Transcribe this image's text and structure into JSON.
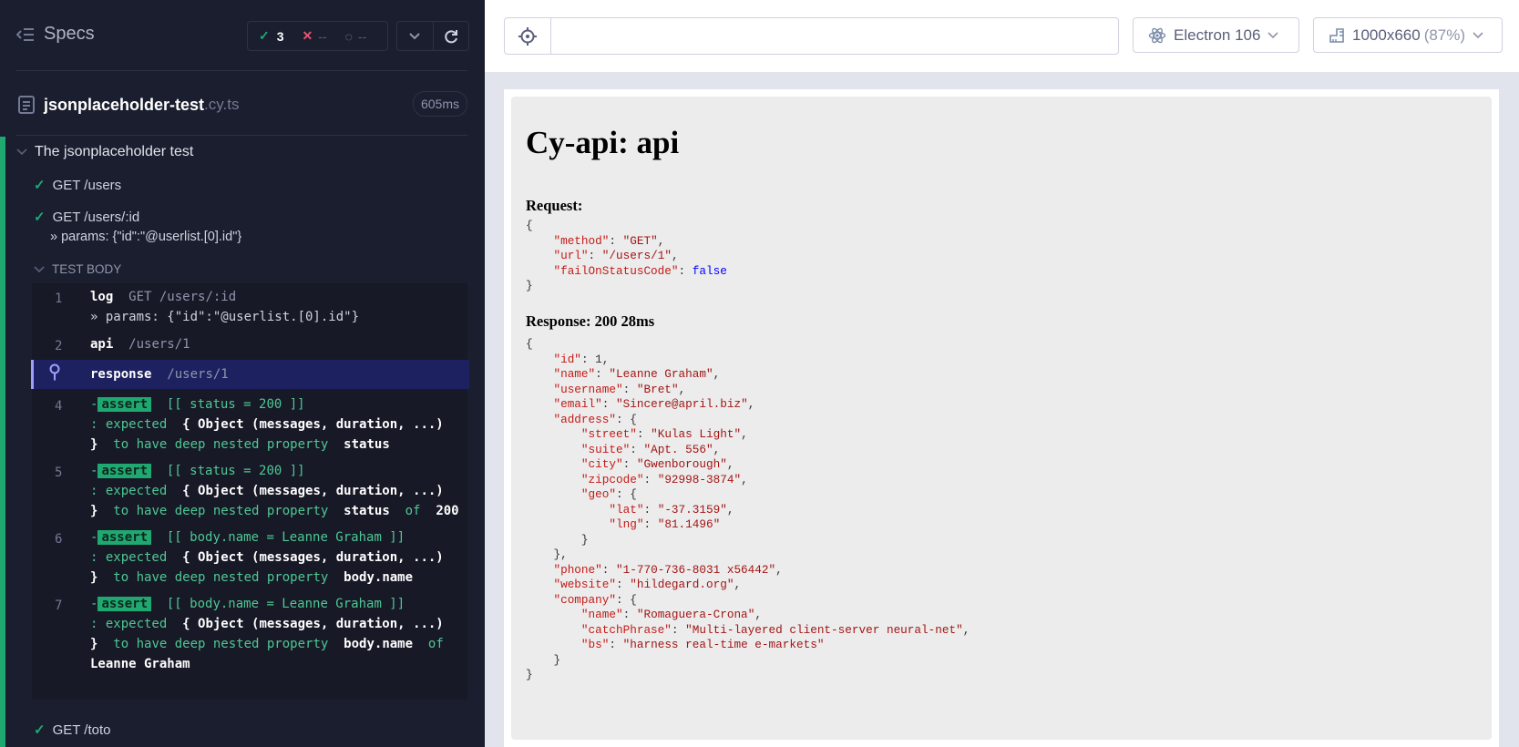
{
  "reporter": {
    "specs_label": "Specs",
    "stats": {
      "passed": "3",
      "failed": "--",
      "pending": "--"
    },
    "spec_file": {
      "name": "jsonplaceholder-test",
      "ext": ".cy.ts",
      "duration": "605ms"
    },
    "suite_title": "The jsonplaceholder test",
    "tests": [
      {
        "title": "GET /users"
      },
      {
        "title": "GET /users/:id",
        "params": "» params: {\"id\":\"@userlist.[0].id\"}"
      },
      {
        "title": "GET /toto"
      }
    ],
    "test_body_label": "TEST BODY",
    "commands": [
      {
        "num": "1",
        "name": "log",
        "msg": "GET /users/:id",
        "msg2": "» params: {\"id\":\"@userlist.[0].id\"}"
      },
      {
        "num": "2",
        "name": "api",
        "msg": "/users/1"
      },
      {
        "num": "",
        "name": "response",
        "msg": "/users/1"
      },
      {
        "num": "4",
        "dash": "-",
        "badge": "assert",
        "expr": "[[ status = 200 ]]",
        "l2a": ": expected",
        "l2b": "{ Object (messages, duration, ...)",
        "l3a": "}",
        "l3b": "to have deep nested property",
        "l3c": "status"
      },
      {
        "num": "5",
        "dash": "-",
        "badge": "assert",
        "expr": "[[ status = 200 ]]",
        "l2a": ": expected",
        "l2b": "{ Object (messages, duration, ...)",
        "l3a": "}",
        "l3b": "to have deep nested property",
        "l3c": "status",
        "l3d": "of",
        "l3e": "200"
      },
      {
        "num": "6",
        "dash": "-",
        "badge": "assert",
        "expr": "[[ body.name = Leanne Graham ]]",
        "l2a": ": expected",
        "l2b": "{ Object (messages, duration, ...)",
        "l3a": "}",
        "l3b": "to have deep nested property",
        "l3c": "body.name"
      },
      {
        "num": "7",
        "dash": "-",
        "badge": "assert",
        "expr": "[[ body.name = Leanne Graham ]]",
        "l2a": ": expected",
        "l2b": "{ Object (messages, duration, ...)",
        "l3a": "}",
        "l3b": "to have deep nested property",
        "l3c": "body.name",
        "l3d": "of",
        "l4": "Leanne Graham"
      }
    ]
  },
  "aut": {
    "url_value": "",
    "browser": "Electron 106",
    "viewport_size": "1000x660",
    "viewport_scale": "(87%)",
    "page": {
      "title": "Cy-api: api",
      "request_label": "Request:",
      "response_label": "Response: 200 28ms",
      "request": {
        "method": "GET",
        "url": "/users/1",
        "failOnStatusCode": "false"
      },
      "response": {
        "id": "1",
        "name": "Leanne Graham",
        "username": "Bret",
        "email": "Sincere@april.biz",
        "address": {
          "street": "Kulas Light",
          "suite": "Apt. 556",
          "city": "Gwenborough",
          "zipcode": "92998-3874",
          "geo": {
            "lat": "-37.3159",
            "lng": "81.1496"
          }
        },
        "phone": "1-770-736-8031 x56442",
        "website": "hildegard.org",
        "company": {
          "name": "Romaguera-Crona",
          "catchPhrase": "Multi-layered client-server neural-net",
          "bs": "harness real-time e-markets"
        }
      }
    }
  },
  "colors": {
    "pass": "#1fa971",
    "fail": "#e45770",
    "pinned": "#1e2160",
    "panel": "#1b1e2e"
  }
}
